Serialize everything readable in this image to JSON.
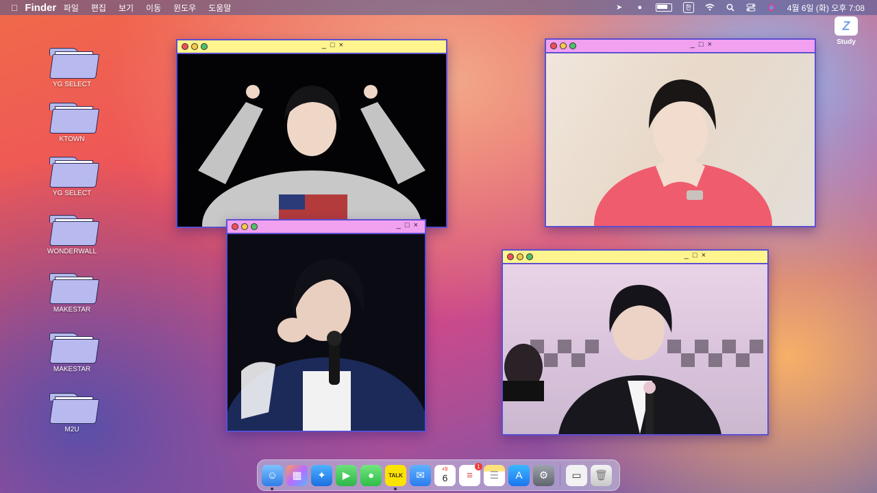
{
  "menubar": {
    "app_name": "Finder",
    "menus": [
      "파일",
      "편집",
      "보기",
      "이동",
      "윈도우",
      "도움말"
    ],
    "ime": "한",
    "clock": "4월 6일 (화) 오후 7:08"
  },
  "study_widget": {
    "label": "Study",
    "logo_glyph": "Z"
  },
  "desktop_icons": [
    {
      "label": "YG SELECT"
    },
    {
      "label": "KTOWN"
    },
    {
      "label": "YG SELECT"
    },
    {
      "label": "WONDERWALL"
    },
    {
      "label": "MAKESTAR"
    },
    {
      "label": "MAKESTAR"
    },
    {
      "label": "M2U"
    }
  ],
  "window_controls": {
    "minimize": "_",
    "maximize": "□",
    "close": "×"
  },
  "dock": {
    "calendar_month": "4월",
    "calendar_day": "6",
    "reminders_badge": "1",
    "talk_label": "TALK"
  },
  "colors": {
    "window_border": "#5b4fd0",
    "titlebar_yellow": "#fff48e",
    "titlebar_pink": "#f2a0f0",
    "folder": "#b7b9ef"
  }
}
